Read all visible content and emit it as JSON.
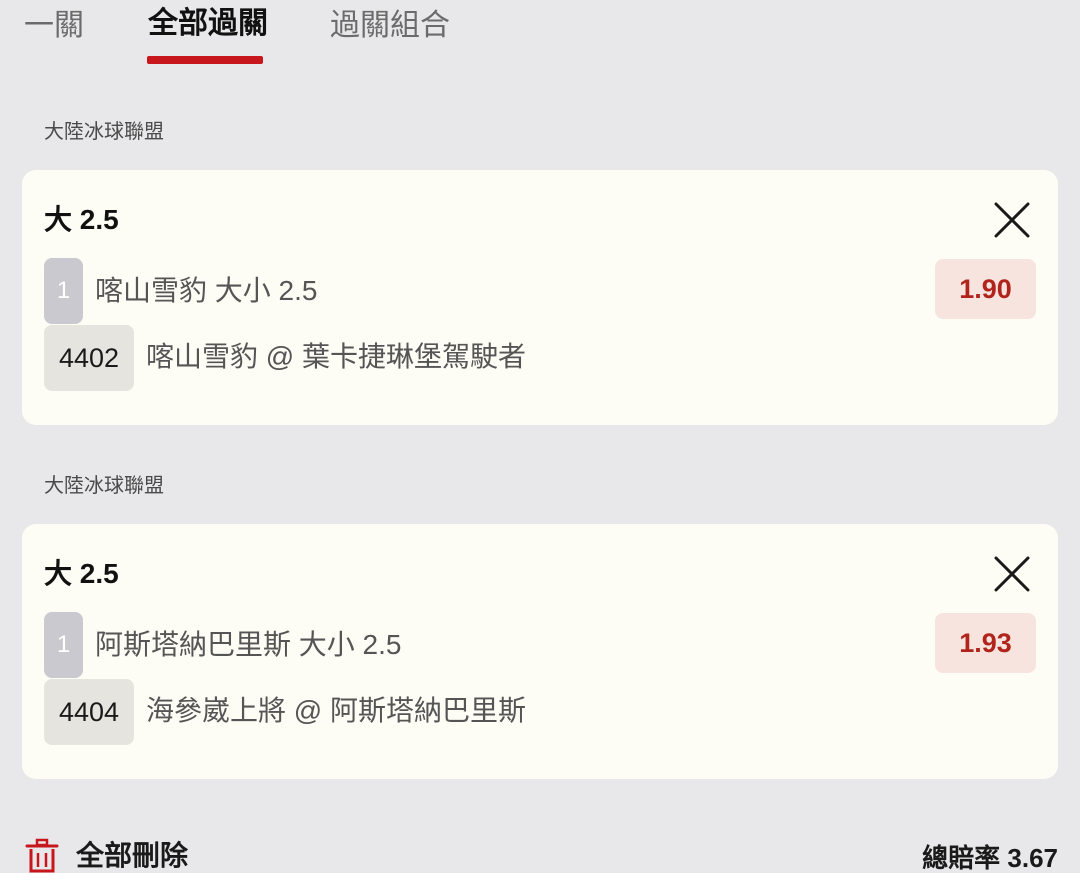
{
  "tabs": [
    {
      "label": "一關"
    },
    {
      "label": "全部過關"
    },
    {
      "label": "過關組合"
    }
  ],
  "bets": [
    {
      "league": "大陸冰球聯盟",
      "title": "大 2.5",
      "leg": "1",
      "selection": "喀山雪豹 大小 2.5",
      "odds": "1.90",
      "match_no": "4402",
      "match": "喀山雪豹 @ 葉卡捷琳堡駕駛者"
    },
    {
      "league": "大陸冰球聯盟",
      "title": "大 2.5",
      "leg": "1",
      "selection": "阿斯塔納巴里斯 大小 2.5",
      "odds": "1.93",
      "match_no": "4404",
      "match": "海參崴上將 @ 阿斯塔納巴里斯"
    }
  ],
  "footer": {
    "delete_all_label": "全部刪除",
    "total_odds_label": "總賠率",
    "total_odds_value": "3.67"
  },
  "icons": {
    "close": "close-icon",
    "trash": "trash-icon"
  },
  "colors": {
    "accent": "#c8161d",
    "odds_text": "#b0241c",
    "odds_bg": "#f7e4df",
    "card_bg": "#fdfcf5",
    "page_bg": "#e8e8ea"
  }
}
